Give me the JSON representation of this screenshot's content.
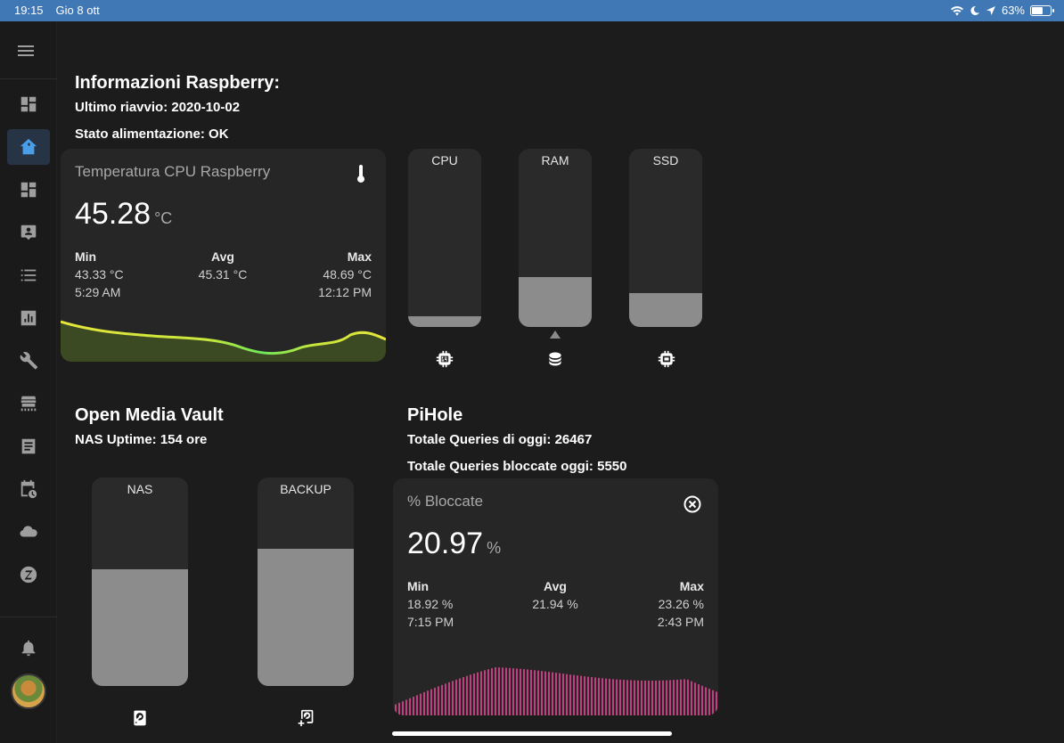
{
  "status_bar": {
    "time": "19:15",
    "date": "Gio 8 ott",
    "battery": "63%",
    "battery_level": 0.63
  },
  "sidebar": {
    "icons": [
      "menu-icon",
      "dashboard-icon",
      "home-assistant-icon",
      "dashboard-icon",
      "person-card-icon",
      "list-icon",
      "chart-icon",
      "wrench-icon",
      "hacs-icon",
      "log-icon",
      "calendar-clock-icon",
      "cloud-icon",
      "zigbee-icon",
      "bell-icon"
    ],
    "active": "home-assistant-icon"
  },
  "raspberry": {
    "title": "Informazioni Raspberry:",
    "last_reboot": "Ultimo riavvio: 2020-10-02",
    "power_state": "Stato alimentazione: OK",
    "temp_card": {
      "name": "Temperatura CPU Raspberry",
      "icon": "thermometer-icon",
      "value": "45.28",
      "unit": "°C",
      "min_label": "Min",
      "min_value": "43.33 °C",
      "min_time": "5:29 AM",
      "avg_label": "Avg",
      "avg_value": "45.31 °C",
      "max_label": "Max",
      "max_value": "48.69 °C",
      "max_time": "12:12 PM"
    },
    "bars": [
      {
        "label": "CPU",
        "level": 0.06,
        "icon": "cpu-64-icon"
      },
      {
        "label": "RAM",
        "level": 0.28,
        "icon": "database-icon"
      },
      {
        "label": "SSD",
        "level": 0.19,
        "icon": "chip-icon"
      }
    ]
  },
  "omv": {
    "title": "Open Media Vault",
    "uptime": "NAS Uptime: 154 ore",
    "bars": [
      {
        "label": "NAS",
        "level": 0.56,
        "icon": "harddisk-icon"
      },
      {
        "label": "BACKUP",
        "level": 0.66,
        "icon": "harddisk-plus-icon"
      }
    ]
  },
  "pihole": {
    "title": "PiHole",
    "queries_today": "Totale Queries di oggi: 26467",
    "queries_blocked": "Totale Queries bloccate oggi: 5550",
    "blocked_card": {
      "name": "% Bloccate",
      "icon": "close-circle-icon",
      "value": "20.97",
      "unit": "%",
      "min_label": "Min",
      "min_value": "18.92 %",
      "min_time": "7:15 PM",
      "avg_label": "Avg",
      "avg_value": "21.94 %",
      "max_label": "Max",
      "max_value": "23.26 %",
      "max_time": "2:43 PM"
    }
  },
  "colors": {
    "accent": "#4a9ee8",
    "temp_line_warm": "#e6e63c",
    "temp_line_cool": "#6ee65a",
    "pihole_bars": "#c2407f",
    "bar_fill": "#8c8c8c"
  }
}
